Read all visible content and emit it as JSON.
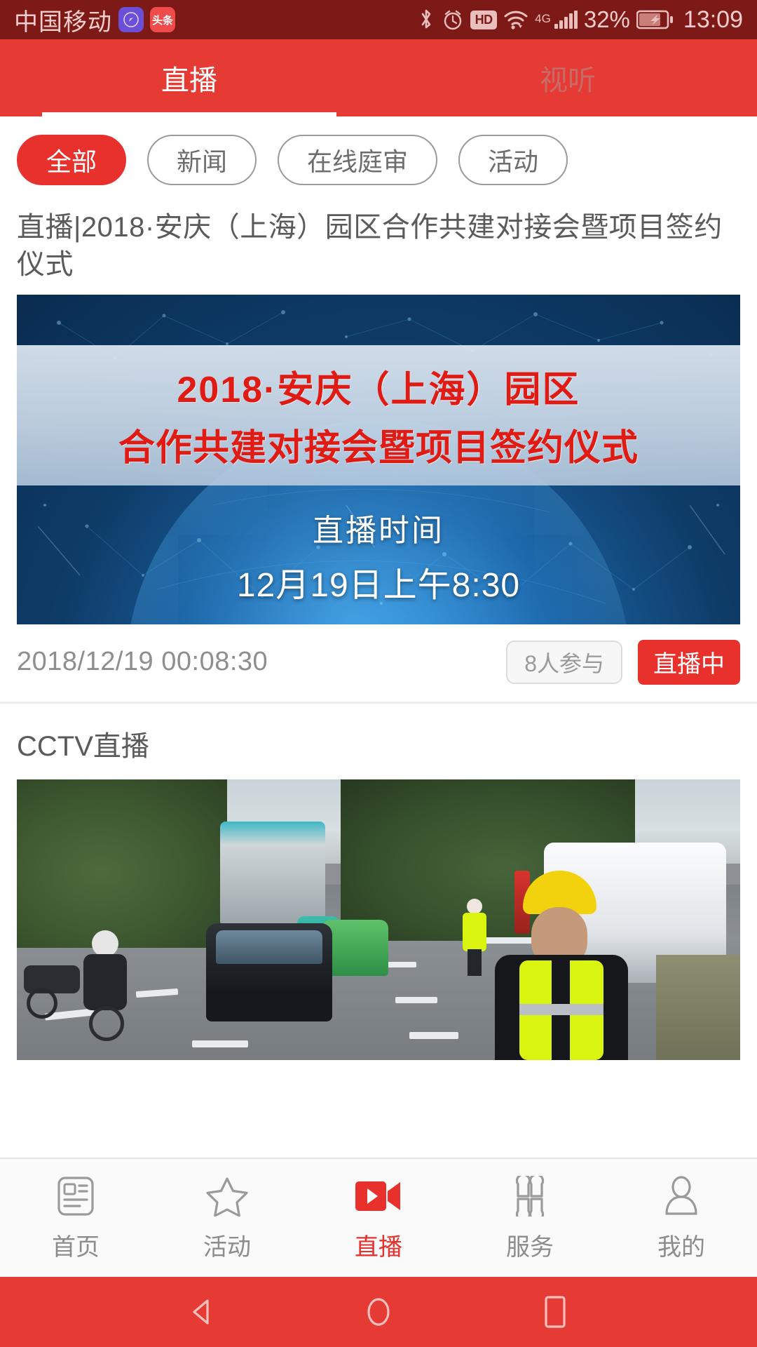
{
  "status_bar": {
    "carrier": "中国移动",
    "app_icons": [
      {
        "name": "compass-app-icon",
        "glyph": "◓"
      },
      {
        "name": "toutiao-app-icon",
        "glyph": "头条"
      }
    ],
    "icons": [
      "bluetooth-icon",
      "alarm-icon",
      "hd-icon",
      "wifi-icon",
      "signal-icon",
      "battery-icon"
    ],
    "hd_label": "HD",
    "network_type": "4G",
    "battery_percent": "32%",
    "time": "13:09",
    "bg_color": "#7d1a17"
  },
  "header": {
    "accent_color": "#e63a35",
    "tabs": [
      {
        "label": "直播",
        "active": true
      },
      {
        "label": "视听",
        "active": false
      }
    ]
  },
  "filters": {
    "chips": [
      {
        "label": "全部",
        "active": true
      },
      {
        "label": "新闻",
        "active": false
      },
      {
        "label": "在线庭审",
        "active": false
      },
      {
        "label": "活动",
        "active": false
      }
    ],
    "active_color": "#e8312c"
  },
  "live_card": {
    "title": "直播|2018·安庆（上海）园区合作共建对接会暨项目签约仪式",
    "poster": {
      "headline_line1": "2018·安庆（上海）园区",
      "headline_line2": "合作共建对接会暨项目签约仪式",
      "time_label": "直播时间",
      "time_value": "12月19日上午8:30",
      "headline_color": "#e01b14"
    },
    "timestamp": "2018/12/19 00:08:30",
    "participants": "8人参与",
    "status_badge": "直播中",
    "status_color": "#e8312c"
  },
  "cctv_section": {
    "title": "CCTV直播"
  },
  "bottom_nav": {
    "items": [
      {
        "label": "首页",
        "icon": "news-card-icon",
        "active": false
      },
      {
        "label": "活动",
        "icon": "star-icon",
        "active": false
      },
      {
        "label": "直播",
        "icon": "video-camera-icon",
        "active": true
      },
      {
        "label": "服务",
        "icon": "grid-petals-icon",
        "active": false
      },
      {
        "label": "我的",
        "icon": "person-icon",
        "active": false
      }
    ],
    "active_color": "#e8312c"
  },
  "android_nav": {
    "buttons": [
      {
        "name": "back-button",
        "shape": "triangle-left"
      },
      {
        "name": "home-button",
        "shape": "circle"
      },
      {
        "name": "recents-button",
        "shape": "square"
      }
    ]
  }
}
